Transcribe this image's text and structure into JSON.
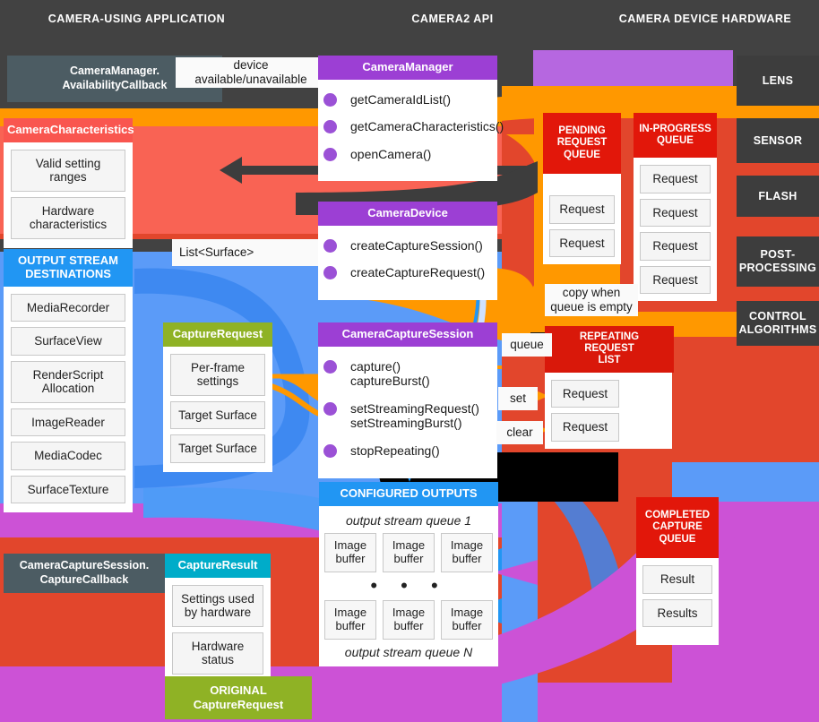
{
  "columns": [
    {
      "label": "CAMERA-USING APPLICATION"
    },
    {
      "label": "CAMERA2 API"
    },
    {
      "label": "CAMERA DEVICE HARDWARE"
    }
  ],
  "callbacks": {
    "availability": "CameraManager.\nAvailabilityCallback",
    "capture": "CameraCaptureSession.\nCaptureCallback"
  },
  "tags": {
    "device_availability": "device\navailable/unavailable",
    "list_surface": "List<Surface>",
    "copy_when_empty": "copy when\nqueue is empty",
    "queue": "queue",
    "set": "set",
    "clear": "clear"
  },
  "cards": {
    "camera_characteristics": {
      "title": "CameraCharacteristics",
      "color": "#f9564f",
      "items": [
        "Valid setting\nranges",
        "Hardware\ncharacteristics"
      ]
    },
    "output_stream_destinations": {
      "title": "OUTPUT STREAM\nDESTINATIONS",
      "color": "#2196f3",
      "items": [
        "MediaRecorder",
        "SurfaceView",
        "RenderScript\nAllocation",
        "ImageReader",
        "MediaCodec",
        "SurfaceTexture"
      ]
    },
    "capture_request": {
      "title": "CaptureRequest",
      "color": "#8fb225",
      "items": [
        "Per-frame\nsettings",
        "Target Surface",
        "Target Surface"
      ]
    },
    "capture_result": {
      "title": "CaptureResult",
      "color": "#00acc9",
      "items": [
        "Settings used\nby hardware",
        "Hardware\nstatus"
      ]
    },
    "original_capture_request": {
      "title": "ORIGINAL\nCaptureRequest",
      "color": "#8fb225"
    },
    "camera_manager": {
      "title": "CameraManager",
      "color": "#9c3fd4",
      "methods": [
        "getCameraIdList()",
        "getCameraCharacteristics()",
        "openCamera()"
      ]
    },
    "camera_device": {
      "title": "CameraDevice",
      "color": "#9c3fd4",
      "methods": [
        "createCaptureSession()",
        "createCaptureRequest()"
      ]
    },
    "camera_capture_session": {
      "title": "CameraCaptureSession",
      "color": "#9c3fd4",
      "methods": [
        "capture()\ncaptureBurst()",
        "setStreamingRequest()\nsetStreamingBurst()",
        "stopRepeating()"
      ]
    },
    "pending_request_queue": {
      "title": "PENDING\nREQUEST\nQUEUE",
      "color": "#e2170a",
      "items": [
        "Request",
        "Request"
      ]
    },
    "in_progress_queue": {
      "title": "IN-PROGRESS\nQUEUE",
      "color": "#e2170a",
      "items": [
        "Request",
        "Request",
        "Request",
        "Request"
      ]
    },
    "repeating_request_list": {
      "title": "REPEATING\nREQUEST\nLIST",
      "color": "#d9180a",
      "items": [
        "Request",
        "Request"
      ]
    },
    "completed_capture_queue": {
      "title": "COMPLETED\nCAPTURE\nQUEUE",
      "color": "#e2170a",
      "items": [
        "Result",
        "Results"
      ]
    },
    "configured_outputs": {
      "title": "CONFIGURED OUTPUTS",
      "color": "#2196f3",
      "queue_top_label": "output stream queue 1",
      "queue_bottom_label": "output stream queue N",
      "buffer_label": "Image\nbuffer",
      "buffers_top": [
        "Image\nbuffer",
        "Image\nbuffer",
        "Image\nbuffer"
      ],
      "buffers_bottom": [
        "Image\nbuffer",
        "Image\nbuffer",
        "Image\nbuffer"
      ],
      "ellipsis": "• • •"
    }
  },
  "hardware": [
    {
      "label": "LENS"
    },
    {
      "label": "SENSOR"
    },
    {
      "label": "FLASH"
    },
    {
      "label": "POST-\nPROCESSING"
    },
    {
      "label": "CONTROL\nALGORITHMS"
    }
  ],
  "colors": {
    "background_dark": "#424242",
    "orange": "#ff9800",
    "salmon": "#f96354",
    "blue": "#5b9bf8",
    "green": "#8fb225",
    "red": "#e2462c",
    "magenta": "#cc52d6",
    "purple": "#b667e0"
  }
}
